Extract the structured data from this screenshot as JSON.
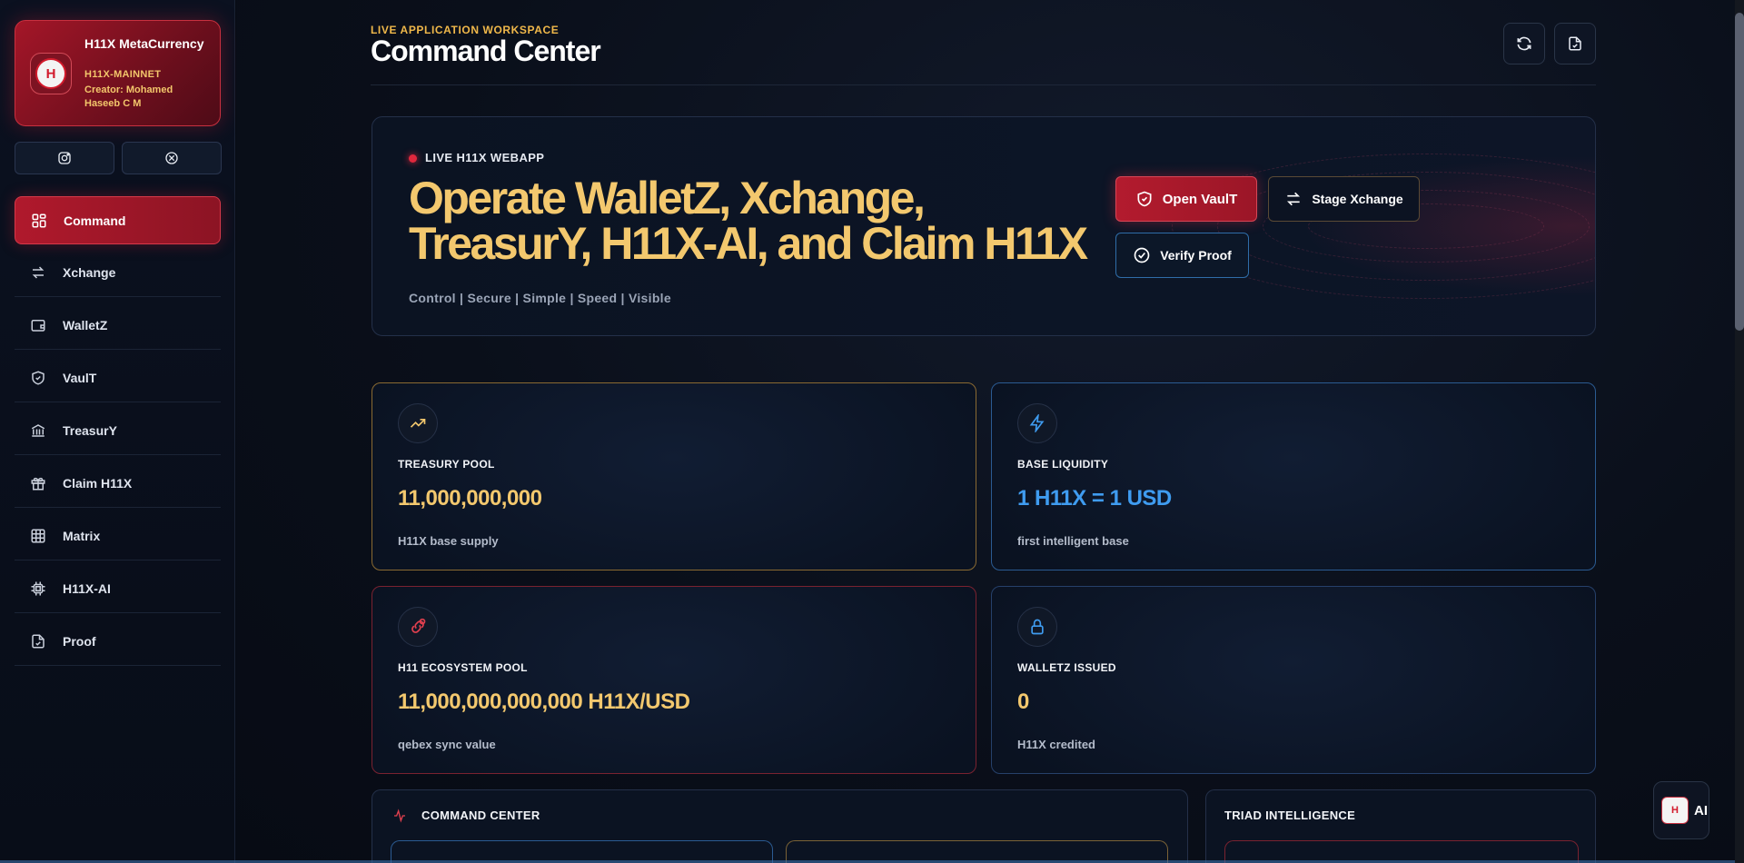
{
  "brand": {
    "name": "H11X MetaCurrency",
    "network": "H11X-MAINNET",
    "creator": "Creator: Mohamed Haseeb C M",
    "logo_text": "H"
  },
  "social": [
    {
      "icon": "instagram-icon"
    },
    {
      "icon": "x-icon"
    }
  ],
  "nav": {
    "items": [
      {
        "label": "Command",
        "icon": "grid-icon",
        "active": true
      },
      {
        "label": "Xchange",
        "icon": "swap-icon"
      },
      {
        "label": "WalletZ",
        "icon": "wallet-icon"
      },
      {
        "label": "VaulT",
        "icon": "shield-icon"
      },
      {
        "label": "TreasurY",
        "icon": "bank-icon"
      },
      {
        "label": "Claim H11X",
        "icon": "gift-icon"
      },
      {
        "label": "Matrix",
        "icon": "table-icon"
      },
      {
        "label": "H11X-AI",
        "icon": "chip-icon"
      },
      {
        "label": "Proof",
        "icon": "file-check-icon"
      }
    ]
  },
  "header": {
    "eyebrow": "LIVE APPLICATION WORKSPACE",
    "title": "Command Center"
  },
  "hero": {
    "live_label": "LIVE H11X WEBAPP",
    "title": "Operate WalletZ, Xchange, TreasurY, H11X-AI, and Claim H11X",
    "subtitle": "Control | Secure | Simple | Speed | Visible",
    "buttons": {
      "open_vault": "Open VaulT",
      "stage_xchange": "Stage Xchange",
      "verify_proof": "Verify Proof"
    }
  },
  "stats": [
    {
      "label": "TREASURY POOL",
      "value": "11,000,000,000",
      "desc": "H11X base supply",
      "color": "#f3c86e",
      "icon": "trending-up-icon"
    },
    {
      "label": "BASE LIQUIDITY",
      "value": "1 H11X = 1 USD",
      "desc": "first intelligent base",
      "color": "#3f9cf0",
      "icon": "lightning-icon"
    },
    {
      "label": "H11 ECOSYSTEM POOL",
      "value": "11,000,000,000,000 H11X/USD",
      "desc": "qebex sync value",
      "color": "#f3c86e",
      "icon": "link-alert-icon"
    },
    {
      "label": "WALLETZ ISSUED",
      "value": "0",
      "desc": "H11X credited",
      "color": "#f3c86e",
      "icon": "lock-icon"
    }
  ],
  "panels": {
    "command_center": "COMMAND CENTER",
    "triad_intelligence": "TRIAD INTELLIGENCE"
  },
  "ai_fab": {
    "label": "AI"
  },
  "colors": {
    "accent_red": "#b31b2e",
    "gold": "#f3c86e",
    "blue": "#3f9cf0",
    "background": "#070b14"
  }
}
